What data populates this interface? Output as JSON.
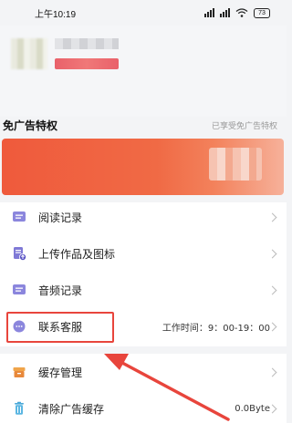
{
  "status_bar": {
    "time": "上午10:19",
    "battery": "73"
  },
  "privilege": {
    "title": "免广告特权",
    "note": "已享受免广告特权"
  },
  "menu": {
    "items": [
      {
        "label": "阅读记录",
        "icon": "chat-icon",
        "extra": ""
      },
      {
        "label": "上传作品及图标",
        "icon": "upload-doc-icon",
        "extra": ""
      },
      {
        "label": "音频记录",
        "icon": "chat-icon",
        "extra": ""
      },
      {
        "label": "联系客服",
        "icon": "message-icon",
        "extra": "工作时间：9：00-19：00"
      },
      {
        "label": "缓存管理",
        "icon": "box-icon",
        "extra": ""
      },
      {
        "label": "清除广告缓存",
        "icon": "trash-icon",
        "extra": "0.0Byte"
      }
    ]
  },
  "colors": {
    "accent": "#e8453c",
    "icon_purple": "#7f79d6",
    "banner": "#ef5a3c"
  }
}
